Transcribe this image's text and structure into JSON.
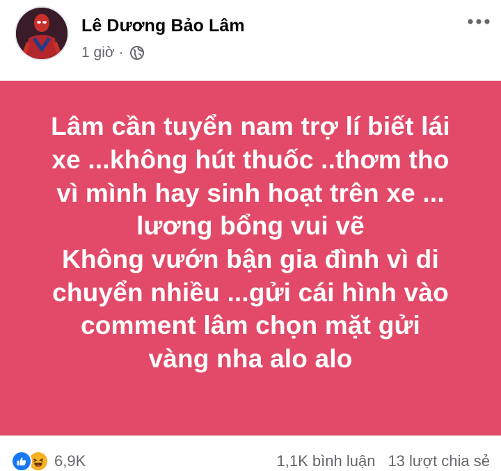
{
  "post": {
    "author": "Lê Dương Bảo Lâm",
    "time": "1 giờ",
    "separator": "·",
    "privacy_icon": "globe-icon",
    "more_icon": "more-horizontal-icon",
    "background_color": "#e34a69",
    "text": "Lâm cần tuyển nam trợ lí biết lái\nxe ...không hút thuốc ..thơm tho\nvì mình hay sinh hoạt trên xe ...\nlương bổng vui vẽ\nKhông vướn bận gia đình vì di\nchuyển nhiều ...gửi cái hình vào\ncomment lâm chọn mặt gửi\nvàng nha  alo alo"
  },
  "footer": {
    "reaction_icons": [
      "like-icon",
      "haha-icon"
    ],
    "reaction_count": "6,9K",
    "comments": "1,1K bình luận",
    "shares": "13 lượt chia sẻ"
  }
}
